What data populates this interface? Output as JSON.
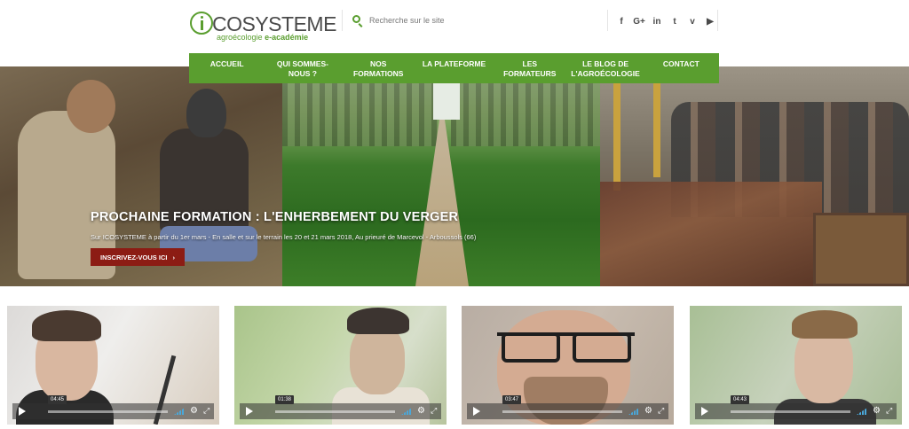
{
  "logo": {
    "word": "COSYSTEME",
    "tagline_prefix": "agroécologie",
    "tagline_bold": "e-académie"
  },
  "search": {
    "placeholder": "Recherche sur le site"
  },
  "social": [
    "f",
    "G+",
    "in",
    "t",
    "v",
    "▶"
  ],
  "nav": [
    "ACCUEIL",
    "QUI SOMMES-\nNOUS ?",
    "NOS\nFORMATIONS",
    "LA PLATEFORME",
    "LES\nFORMATEURS",
    "LE BLOG DE\nL'AGROÉCOLOGIE",
    "CONTACT"
  ],
  "hero": {
    "title": "PROCHAINE FORMATION : L'ENHERBEMENT DU VERGER",
    "subtitle": "Sur ICOSYSTEME à partir du 1er mars - En salle et sur le terrain les 20 et 21 mars 2018, Au prieuré de Marcevol - Arboussols (66)",
    "button": "INSCRIVEZ-VOUS ICI",
    "button_arrow": "›"
  },
  "videos": [
    {
      "time": "04:45"
    },
    {
      "time": "01:38"
    },
    {
      "time": "03:47"
    },
    {
      "time": "04:43"
    }
  ],
  "colors": {
    "brand_green": "#5a9e2f",
    "cta_red": "#8c1c14"
  }
}
